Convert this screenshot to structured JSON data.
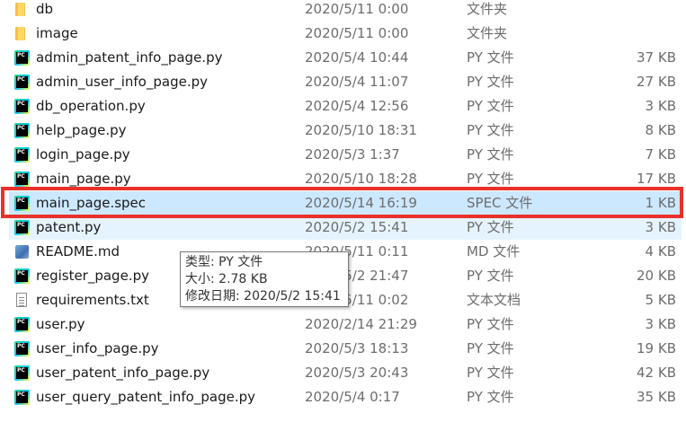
{
  "files": [
    {
      "name": "db",
      "date": "2020/5/11 0:00",
      "type": "文件夹",
      "size": "",
      "icon": "folder-icon"
    },
    {
      "name": "image",
      "date": "2020/5/11 0:00",
      "type": "文件夹",
      "size": "",
      "icon": "folder-icon"
    },
    {
      "name": "admin_patent_info_page.py",
      "date": "2020/5/4 10:44",
      "type": "PY 文件",
      "size": "37 KB",
      "icon": "pycharm-file-icon"
    },
    {
      "name": "admin_user_info_page.py",
      "date": "2020/5/4 11:07",
      "type": "PY 文件",
      "size": "27 KB",
      "icon": "pycharm-file-icon"
    },
    {
      "name": "db_operation.py",
      "date": "2020/5/4 12:56",
      "type": "PY 文件",
      "size": "3 KB",
      "icon": "pycharm-file-icon"
    },
    {
      "name": "help_page.py",
      "date": "2020/5/10 18:31",
      "type": "PY 文件",
      "size": "8 KB",
      "icon": "pycharm-file-icon"
    },
    {
      "name": "login_page.py",
      "date": "2020/5/3 1:37",
      "type": "PY 文件",
      "size": "7 KB",
      "icon": "pycharm-file-icon"
    },
    {
      "name": "main_page.py",
      "date": "2020/5/10 18:28",
      "type": "PY 文件",
      "size": "17 KB",
      "icon": "pycharm-file-icon"
    },
    {
      "name": "main_page.spec",
      "date": "2020/5/14 16:19",
      "type": "SPEC 文件",
      "size": "1 KB",
      "icon": "pycharm-file-icon"
    },
    {
      "name": "patent.py",
      "date": "2020/5/2 15:41",
      "type": "PY 文件",
      "size": "3 KB",
      "icon": "pycharm-file-icon"
    },
    {
      "name": "README.md",
      "date": "2020/5/11 0:11",
      "type": "MD 文件",
      "size": "4 KB",
      "icon": "markdown-file-icon"
    },
    {
      "name": "register_page.py",
      "date": "2020/5/2 21:47",
      "type": "PY 文件",
      "size": "20 KB",
      "icon": "pycharm-file-icon"
    },
    {
      "name": "requirements.txt",
      "date": "2020/5/11 0:02",
      "type": "文本文档",
      "size": "5 KB",
      "icon": "text-file-icon"
    },
    {
      "name": "user.py",
      "date": "2020/2/14 21:29",
      "type": "PY 文件",
      "size": "3 KB",
      "icon": "pycharm-file-icon"
    },
    {
      "name": "user_info_page.py",
      "date": "2020/5/3 18:13",
      "type": "PY 文件",
      "size": "19 KB",
      "icon": "pycharm-file-icon"
    },
    {
      "name": "user_patent_info_page.py",
      "date": "2020/5/3 20:43",
      "type": "PY 文件",
      "size": "42 KB",
      "icon": "pycharm-file-icon"
    },
    {
      "name": "user_query_patent_info_page.py",
      "date": "2020/5/4 0:17",
      "type": "PY 文件",
      "size": "35 KB",
      "icon": "pycharm-file-icon"
    }
  ],
  "selected_file": "main_page.spec",
  "hovered_file": "patent.py",
  "tooltip": {
    "type_line": "类型: PY 文件",
    "size_line": "大小: 2.78 KB",
    "modified_line": "修改日期: 2020/5/2 15:41"
  },
  "colors": {
    "selection_bg": "#cce8ff",
    "hover_bg": "#e5f3ff",
    "highlight_frame": "#e8312b"
  }
}
